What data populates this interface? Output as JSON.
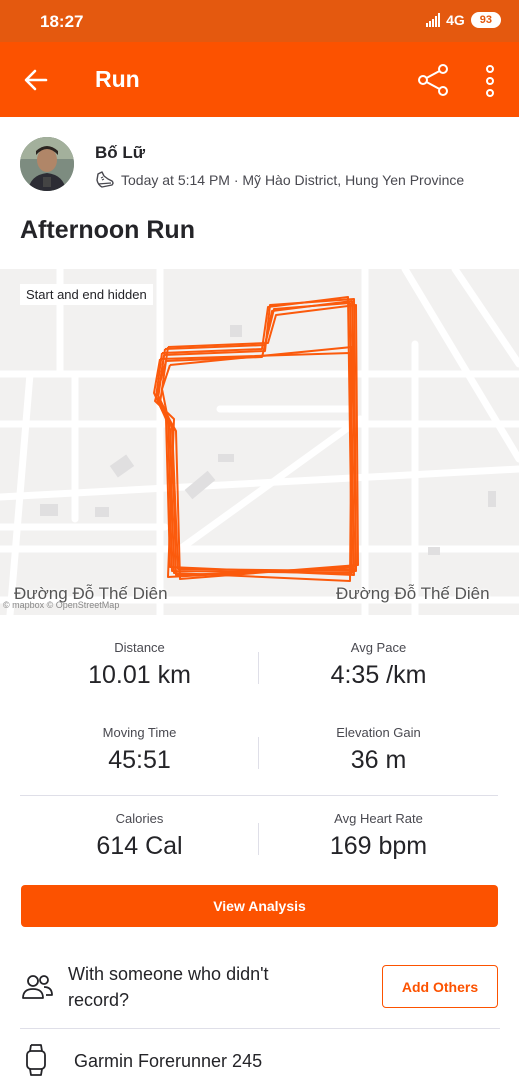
{
  "status_bar": {
    "time": "18:27",
    "network": "4G",
    "battery": "93"
  },
  "app_bar": {
    "title": "Run",
    "icons": [
      "back-arrow-icon",
      "share-icon",
      "more-vertical-icon"
    ]
  },
  "athlete": {
    "name": "Bố Lữ",
    "meta": "Today at 5:14 PM · Mỹ Hào District, Hung Yen Province",
    "icons": [
      "avatar",
      "shoe-icon"
    ]
  },
  "activity": {
    "title": "Afternoon Run"
  },
  "map": {
    "privacy_badge": "Start and end hidden",
    "street_left": "Đường Đỗ Thế Diên",
    "street_right": "Đường Đỗ Thế Diên",
    "attribution": "© mapbox © OpenStreetMap",
    "route_color": "#fc5200"
  },
  "stats": [
    {
      "label": "Distance",
      "value": "10.01 km"
    },
    {
      "label": "Avg Pace",
      "value": "4:35 /km"
    },
    {
      "label": "Moving Time",
      "value": "45:51"
    },
    {
      "label": "Elevation Gain",
      "value": "36 m"
    },
    {
      "label": "Calories",
      "value": "614 Cal"
    },
    {
      "label": "Avg Heart Rate",
      "value": "169 bpm"
    }
  ],
  "actions": {
    "view_analysis": "View Analysis"
  },
  "others": {
    "text": "With someone who didn't record?",
    "button": "Add Others",
    "icon": "people-icon"
  },
  "device": {
    "name": "Garmin Forerunner 245",
    "icon": "watch-icon"
  },
  "colors": {
    "brand": "#fc5200",
    "status_bar": "#e4590f",
    "text": "#242428"
  }
}
